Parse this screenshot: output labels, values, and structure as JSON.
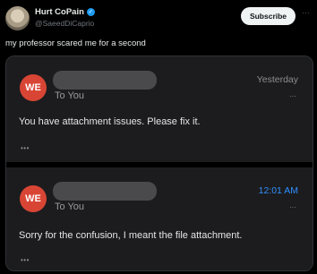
{
  "tweet": {
    "author_name": "Hurt CoPain",
    "handle": "@SaeedDiCaprio",
    "verified_glyph": "✓",
    "subscribe_label": "Subscribe",
    "more_label": "···",
    "text": "my professor scared me for a second"
  },
  "emails": [
    {
      "avatar_initials": "WE",
      "recipient": "To You",
      "time": "Yesterday",
      "time_color": "#8e8e93",
      "options_label": "···",
      "body": "You have attachment issues. Please fix it.",
      "expand_label": "•••"
    },
    {
      "avatar_initials": "WE",
      "recipient": "To You",
      "time": "12:01 AM",
      "time_color": "#2f8fff",
      "options_label": "···",
      "body": "Sorry for the confusion, I meant the file attachment.",
      "expand_label": "•••"
    }
  ],
  "colors": {
    "accent_blue": "#1d9bf0",
    "avatar_red": "#d94534"
  }
}
